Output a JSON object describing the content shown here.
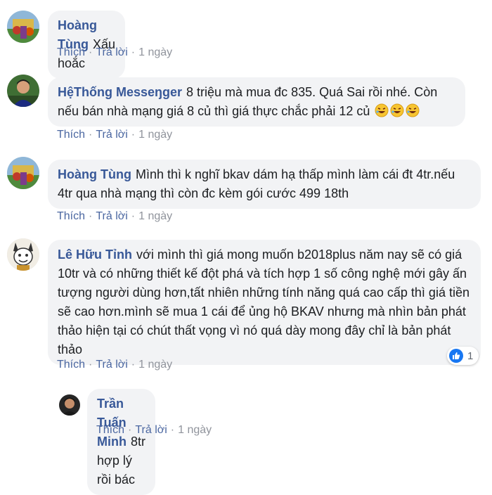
{
  "comments": [
    {
      "author": "Hoàng Tùng",
      "text": "Xấu hoắc",
      "like_label": "Thích",
      "reply_label": "Trả lời",
      "time": "1 ngày"
    },
    {
      "author": "HệThống Messeŋger",
      "text": "8 triệu mà mua đc 835. Quá Sai rồi nhé. Còn nếu bán nhà mạng giá 8 củ thì giá thực chắc phải 12 củ",
      "emoji": "rolling-on-floor-laughing-emoji",
      "like_label": "Thích",
      "reply_label": "Trả lời",
      "time": "1 ngày"
    },
    {
      "author": "Hoàng Tùng",
      "text": "Mình thì k nghĩ bkav dám hạ thấp mình làm cái đt 4tr.nếu 4tr qua nhà mạng thì còn đc kèm gói cước 499 18th",
      "like_label": "Thích",
      "reply_label": "Trả lời",
      "time": "1 ngày"
    },
    {
      "author": "Lê Hữu Tỉnh",
      "text": "với mình thì giá mong muốn b2018plus năm nay sẽ có giá 10tr và có những thiết kế đột phá và tích hợp 1 số công nghệ mới gây ấn tượng người dùng hơn,tất nhiên những tính năng quá cao cấp thì giá tiền sẽ cao hơn.mình sẽ mua 1 cái để ủng hộ BKAV nhưng mà nhìn bản phát thảo hiện tại có chút thất vọng vì nó quá dày mong đây chỉ là bản phát thảo",
      "reaction_count": "1",
      "like_label": "Thích",
      "reply_label": "Trả lời",
      "time": "1 ngày"
    },
    {
      "author": "Trần Tuấn Minh",
      "text": "8tr hợp lý rồi bác",
      "like_label": "Thích",
      "reply_label": "Trả lời",
      "time": "1 ngày"
    }
  ],
  "colors": {
    "author": "#385898",
    "bubble": "#f2f3f5",
    "meta": "#90949c",
    "like_blue": "#1877f2"
  }
}
